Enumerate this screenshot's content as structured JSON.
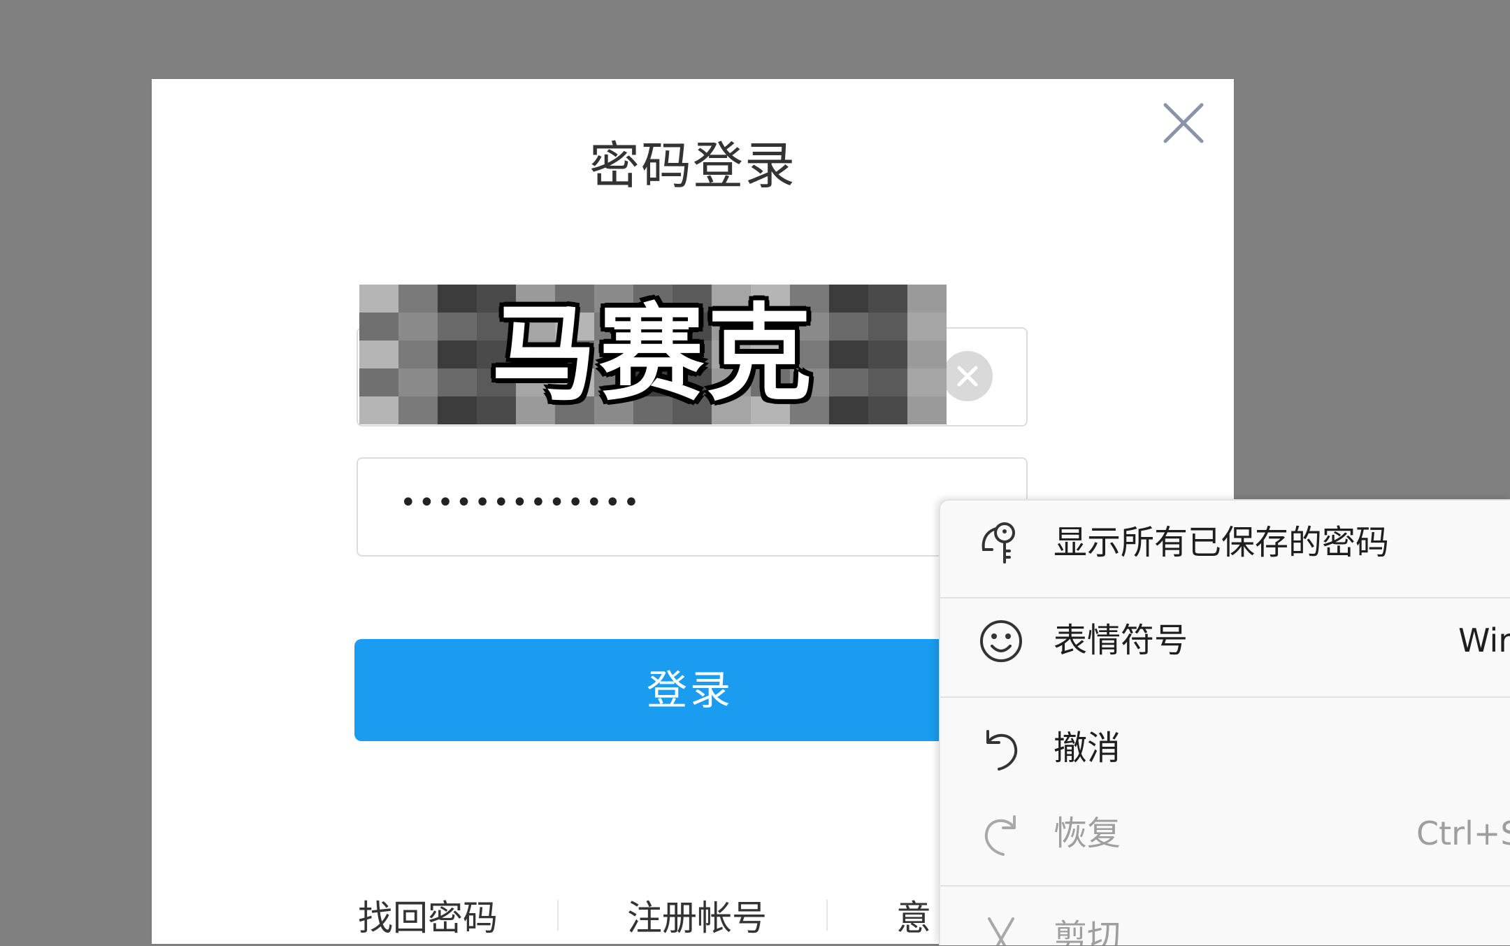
{
  "dialog": {
    "title": "密码登录",
    "account_value": "马赛克",
    "password_value": "•••••••••••••",
    "login_label": "登录",
    "links": [
      "找回密码",
      "注册帐号",
      "意"
    ]
  },
  "context_menu": {
    "items": [
      {
        "icon": "key-icon",
        "label": "显示所有已保存的密码",
        "shortcut": ""
      },
      {
        "icon": "emoji-icon",
        "label": "表情符号",
        "shortcut": "Wir"
      },
      {
        "icon": "undo-icon",
        "label": "撤消",
        "shortcut": ""
      },
      {
        "icon": "redo-icon",
        "label": "恢复",
        "shortcut": "Ctrl+S"
      },
      {
        "icon": "cut-icon",
        "label": "剪切",
        "shortcut": ""
      }
    ]
  },
  "colors": {
    "backdrop": "#808080",
    "primary": "#1a9cf0",
    "menu_bg": "#f9f9f9"
  }
}
